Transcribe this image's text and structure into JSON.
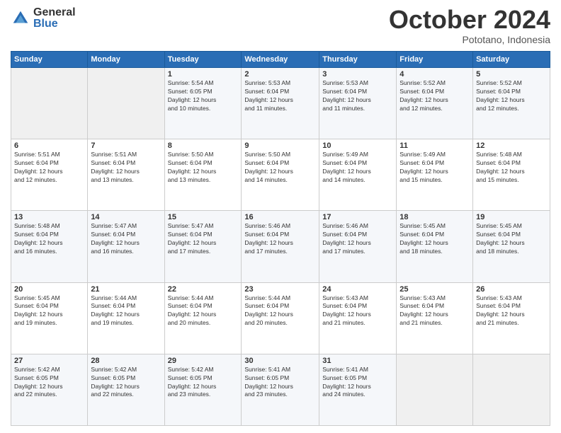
{
  "logo": {
    "general": "General",
    "blue": "Blue"
  },
  "header": {
    "month": "October 2024",
    "location": "Pototano, Indonesia"
  },
  "weekdays": [
    "Sunday",
    "Monday",
    "Tuesday",
    "Wednesday",
    "Thursday",
    "Friday",
    "Saturday"
  ],
  "weeks": [
    [
      {
        "day": "",
        "info": ""
      },
      {
        "day": "",
        "info": ""
      },
      {
        "day": "1",
        "info": "Sunrise: 5:54 AM\nSunset: 6:05 PM\nDaylight: 12 hours\nand 10 minutes."
      },
      {
        "day": "2",
        "info": "Sunrise: 5:53 AM\nSunset: 6:04 PM\nDaylight: 12 hours\nand 11 minutes."
      },
      {
        "day": "3",
        "info": "Sunrise: 5:53 AM\nSunset: 6:04 PM\nDaylight: 12 hours\nand 11 minutes."
      },
      {
        "day": "4",
        "info": "Sunrise: 5:52 AM\nSunset: 6:04 PM\nDaylight: 12 hours\nand 12 minutes."
      },
      {
        "day": "5",
        "info": "Sunrise: 5:52 AM\nSunset: 6:04 PM\nDaylight: 12 hours\nand 12 minutes."
      }
    ],
    [
      {
        "day": "6",
        "info": "Sunrise: 5:51 AM\nSunset: 6:04 PM\nDaylight: 12 hours\nand 12 minutes."
      },
      {
        "day": "7",
        "info": "Sunrise: 5:51 AM\nSunset: 6:04 PM\nDaylight: 12 hours\nand 13 minutes."
      },
      {
        "day": "8",
        "info": "Sunrise: 5:50 AM\nSunset: 6:04 PM\nDaylight: 12 hours\nand 13 minutes."
      },
      {
        "day": "9",
        "info": "Sunrise: 5:50 AM\nSunset: 6:04 PM\nDaylight: 12 hours\nand 14 minutes."
      },
      {
        "day": "10",
        "info": "Sunrise: 5:49 AM\nSunset: 6:04 PM\nDaylight: 12 hours\nand 14 minutes."
      },
      {
        "day": "11",
        "info": "Sunrise: 5:49 AM\nSunset: 6:04 PM\nDaylight: 12 hours\nand 15 minutes."
      },
      {
        "day": "12",
        "info": "Sunrise: 5:48 AM\nSunset: 6:04 PM\nDaylight: 12 hours\nand 15 minutes."
      }
    ],
    [
      {
        "day": "13",
        "info": "Sunrise: 5:48 AM\nSunset: 6:04 PM\nDaylight: 12 hours\nand 16 minutes."
      },
      {
        "day": "14",
        "info": "Sunrise: 5:47 AM\nSunset: 6:04 PM\nDaylight: 12 hours\nand 16 minutes."
      },
      {
        "day": "15",
        "info": "Sunrise: 5:47 AM\nSunset: 6:04 PM\nDaylight: 12 hours\nand 17 minutes."
      },
      {
        "day": "16",
        "info": "Sunrise: 5:46 AM\nSunset: 6:04 PM\nDaylight: 12 hours\nand 17 minutes."
      },
      {
        "day": "17",
        "info": "Sunrise: 5:46 AM\nSunset: 6:04 PM\nDaylight: 12 hours\nand 17 minutes."
      },
      {
        "day": "18",
        "info": "Sunrise: 5:45 AM\nSunset: 6:04 PM\nDaylight: 12 hours\nand 18 minutes."
      },
      {
        "day": "19",
        "info": "Sunrise: 5:45 AM\nSunset: 6:04 PM\nDaylight: 12 hours\nand 18 minutes."
      }
    ],
    [
      {
        "day": "20",
        "info": "Sunrise: 5:45 AM\nSunset: 6:04 PM\nDaylight: 12 hours\nand 19 minutes."
      },
      {
        "day": "21",
        "info": "Sunrise: 5:44 AM\nSunset: 6:04 PM\nDaylight: 12 hours\nand 19 minutes."
      },
      {
        "day": "22",
        "info": "Sunrise: 5:44 AM\nSunset: 6:04 PM\nDaylight: 12 hours\nand 20 minutes."
      },
      {
        "day": "23",
        "info": "Sunrise: 5:44 AM\nSunset: 6:04 PM\nDaylight: 12 hours\nand 20 minutes."
      },
      {
        "day": "24",
        "info": "Sunrise: 5:43 AM\nSunset: 6:04 PM\nDaylight: 12 hours\nand 21 minutes."
      },
      {
        "day": "25",
        "info": "Sunrise: 5:43 AM\nSunset: 6:04 PM\nDaylight: 12 hours\nand 21 minutes."
      },
      {
        "day": "26",
        "info": "Sunrise: 5:43 AM\nSunset: 6:04 PM\nDaylight: 12 hours\nand 21 minutes."
      }
    ],
    [
      {
        "day": "27",
        "info": "Sunrise: 5:42 AM\nSunset: 6:05 PM\nDaylight: 12 hours\nand 22 minutes."
      },
      {
        "day": "28",
        "info": "Sunrise: 5:42 AM\nSunset: 6:05 PM\nDaylight: 12 hours\nand 22 minutes."
      },
      {
        "day": "29",
        "info": "Sunrise: 5:42 AM\nSunset: 6:05 PM\nDaylight: 12 hours\nand 23 minutes."
      },
      {
        "day": "30",
        "info": "Sunrise: 5:41 AM\nSunset: 6:05 PM\nDaylight: 12 hours\nand 23 minutes."
      },
      {
        "day": "31",
        "info": "Sunrise: 5:41 AM\nSunset: 6:05 PM\nDaylight: 12 hours\nand 24 minutes."
      },
      {
        "day": "",
        "info": ""
      },
      {
        "day": "",
        "info": ""
      }
    ]
  ]
}
